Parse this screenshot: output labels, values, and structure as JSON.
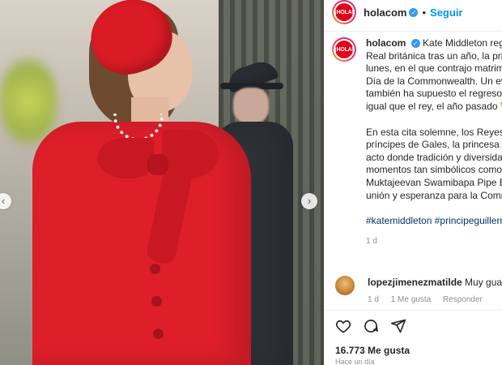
{
  "post": {
    "username": "holacom",
    "avatar_text": "¡HOLA!",
    "follow_label": "Seguir",
    "separator": "•"
  },
  "caption": {
    "p1": "Kate Middleton regresó junto al resto de la Familia Real británica tras un año, la princesa de Gales ha vuelto este lunes, en el que contrajo matrimonio con el príncipe Guillermo, al Día de la Commonwealth. Un evento de gran relevancia que también ha supuesto el regreso tras el diagnóstico de cáncer, al igual que el rey, el año pasado 💝.",
    "p2": "En esta cita solemne, los Reyes han estado acompañados por los príncipes de Gales, la princesa Ana y Sir Timothy Laurence en un acto donde tradición y diversidad han brillado. Uno de los momentos tan simbólicos como la visita de Su Santidad Shree Muktajeevan Swamibapa Pipe Band, un mensaje de significado, unión y esperanza para la Commonwealth.",
    "hashtags": "#katemiddleton #principeguillermo #royals #realezabritanica",
    "time": "1 d"
  },
  "comment": {
    "username": "lopezjimenezmatilde",
    "text": "Muy guapa",
    "time": "1 d",
    "likes": "1 Me gusta",
    "reply": "Responder"
  },
  "likes_count": "16.773 Me gusta",
  "posted_ago": "Hace un día",
  "icons": [
    "heart-icon",
    "comment-icon",
    "share-icon",
    "chevron-left-icon",
    "chevron-right-icon",
    "verified-badge-icon"
  ],
  "colors": {
    "accent": "#0095f6",
    "hashtag": "#00376b",
    "brand_red": "#e2001a",
    "coat_red": "#de1f2a"
  }
}
